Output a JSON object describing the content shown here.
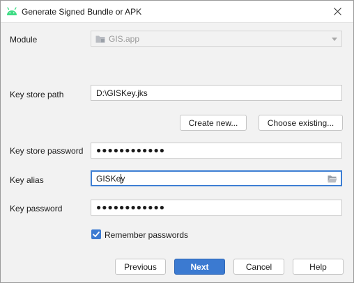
{
  "window": {
    "title": "Generate Signed Bundle or APK",
    "close_glyph": "✕"
  },
  "form": {
    "module": {
      "label": "Module",
      "value": "GIS.app"
    },
    "key_store_path": {
      "label": "Key store path",
      "value": "D:\\GISKey.jks"
    },
    "create_new_label": "Create new...",
    "choose_existing_label": "Choose existing...",
    "key_store_password": {
      "label": "Key store password",
      "value": "●●●●●●●●●●●●"
    },
    "key_alias": {
      "label": "Key alias",
      "value": "GISKey"
    },
    "key_password": {
      "label": "Key password",
      "value": "●●●●●●●●●●●●"
    },
    "remember_passwords": {
      "label": "Remember passwords",
      "checked": true
    }
  },
  "footer": {
    "previous_label": "Previous",
    "next_label": "Next",
    "cancel_label": "Cancel",
    "help_label": "Help"
  },
  "colors": {
    "accent": "#3b7ad1",
    "android_green": "#3ddc84"
  }
}
